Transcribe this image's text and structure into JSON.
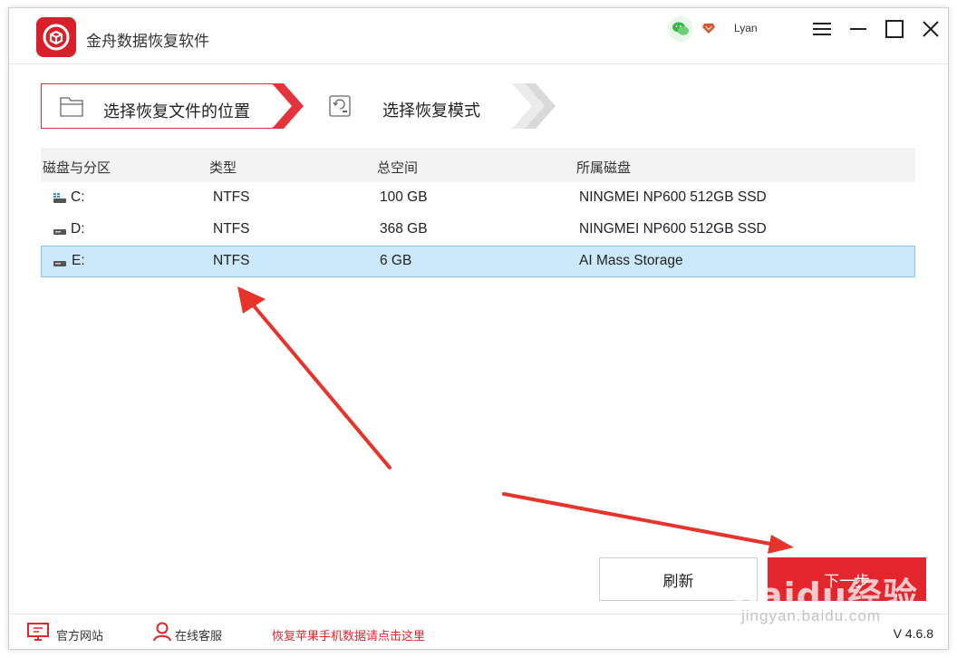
{
  "app": {
    "title": "金舟数据恢复软件"
  },
  "header": {
    "username": "Lyan"
  },
  "steps": [
    {
      "label": "选择恢复文件的位置"
    },
    {
      "label": "选择恢复模式"
    }
  ],
  "table": {
    "headers": [
      "磁盘与分区",
      "类型",
      "总空间",
      "所属磁盘"
    ],
    "rows": [
      {
        "partition": "C:",
        "type": "NTFS",
        "size": "100 GB",
        "disk": "NINGMEI NP600 512GB SSD",
        "selected": false
      },
      {
        "partition": "D:",
        "type": "NTFS",
        "size": "368 GB",
        "disk": "NINGMEI NP600 512GB SSD",
        "selected": false
      },
      {
        "partition": "E:",
        "type": "NTFS",
        "size": "6 GB",
        "disk": "AI Mass Storage",
        "selected": true
      }
    ]
  },
  "buttons": {
    "refresh": "刷新",
    "next": "下一步"
  },
  "footer": {
    "official_site": "官方网站",
    "online_service": "在线客服",
    "apple_recovery": "恢复苹果手机数据请点击这里",
    "version": "V 4.6.8"
  },
  "watermark": {
    "main": "Baidu经验",
    "sub": "jingyan.baidu.com"
  },
  "colors": {
    "accent": "#e3262d",
    "selected_row": "#cce8fb",
    "selected_border": "#86c4ef"
  }
}
